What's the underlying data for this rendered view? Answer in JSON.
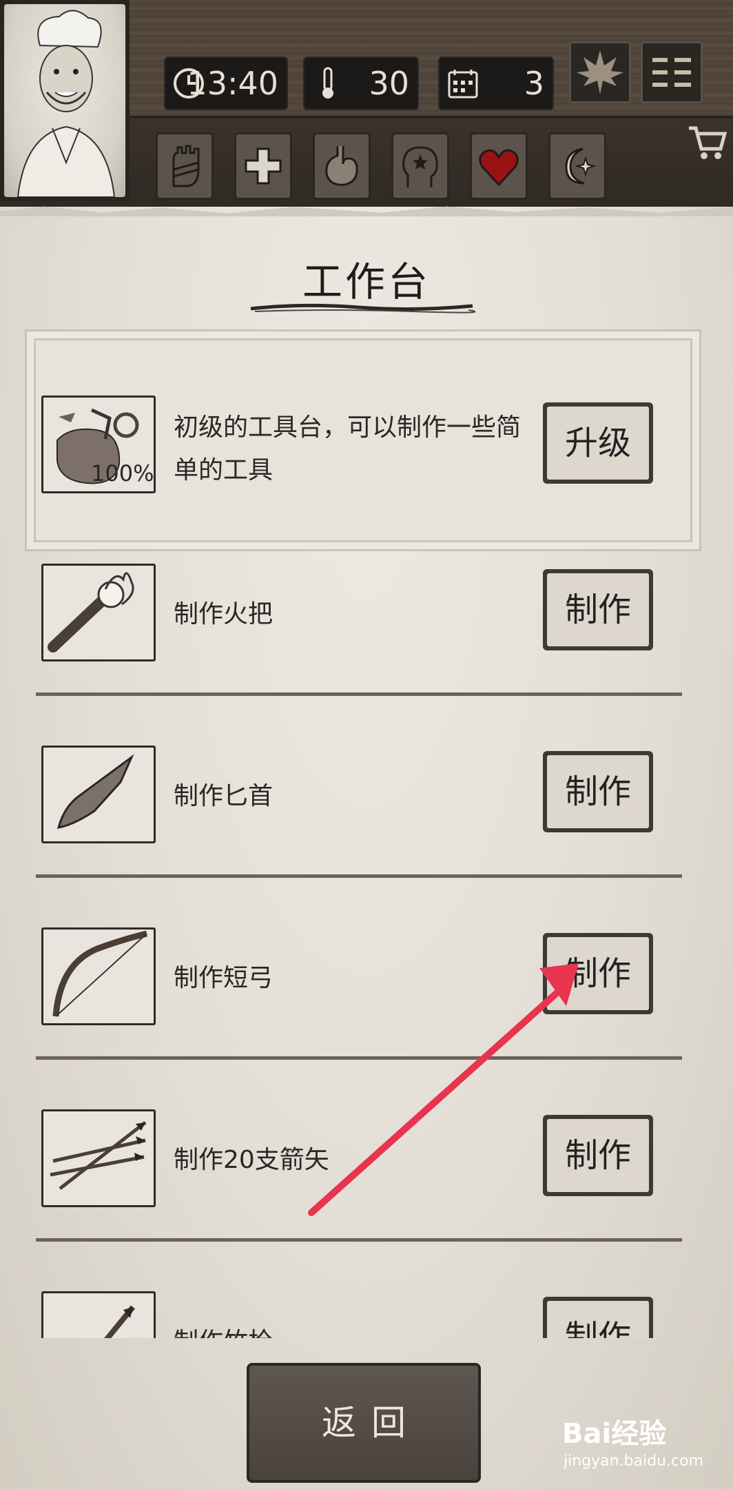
{
  "hud": {
    "time": "13:40",
    "temperature": "30",
    "day": "3",
    "stat_icons": [
      "bandaged-hand-icon",
      "health-cross-icon",
      "stomach-icon",
      "mind-icon",
      "heart-icon",
      "sleep-moon-icon"
    ]
  },
  "page": {
    "title": "工作台"
  },
  "upgrade": {
    "description": "初级的工具台，可以制作一些简单的工具",
    "progress": "100%",
    "button_label": "升级"
  },
  "recipes": [
    {
      "label": "制作火把",
      "button": "制作",
      "icon": "torch-icon"
    },
    {
      "label": "制作匕首",
      "button": "制作",
      "icon": "stone-dagger-icon"
    },
    {
      "label": "制作短弓",
      "button": "制作",
      "icon": "short-bow-icon"
    },
    {
      "label": "制作20支箭矢",
      "button": "制作",
      "icon": "arrows-icon"
    },
    {
      "label": "制作竹枪",
      "button": "制作",
      "icon": "bamboo-spear-icon"
    }
  ],
  "back_button": "返回",
  "watermark": {
    "brand": "Bai经验",
    "url": "jingyan.baidu.com"
  },
  "colors": {
    "paper": "#e8e3da",
    "hud_dark": "#1c1a18",
    "heart": "#9a1212",
    "arrow": "#e8344e"
  }
}
